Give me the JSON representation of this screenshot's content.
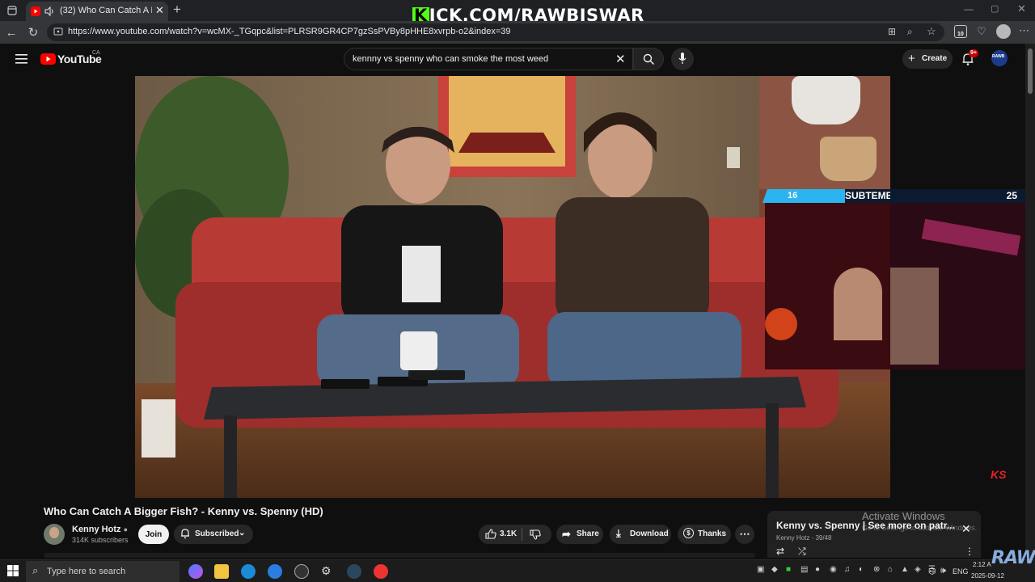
{
  "browser": {
    "tab_title": "(32) Who Can Catch A Bigger",
    "url": "https://www.youtube.com/watch?v=wcMX-_TGqpc&list=PLRSR9GR4CP7gzSsPVBy8pHHE8xvrpb-o2&index=39",
    "extensions_badge": "10"
  },
  "overlay": {
    "brand_k": "K",
    "brand_rest": "ICK.COM/RAWBISWAR"
  },
  "youtube": {
    "logo_text": "YouTube",
    "country_code": "CA",
    "search_query": "kennny vs spenny who can smoke the most weed",
    "create_label": "Create",
    "notif_count": "9+",
    "avatar_text": "RAWB"
  },
  "stream": {
    "goal_start": "16",
    "goal_label": "SUBTEMBER SUB GOAL",
    "goal_end": "25",
    "video_logo": "KS"
  },
  "video": {
    "title": "Who Can Catch A Bigger Fish? - Kenny vs. Spenny (HD)",
    "channel_name": "Kenny Hotz",
    "subscribers": "314K subscribers",
    "join_label": "Join",
    "subscribed_label": "Subscribed",
    "likes": "3.1K",
    "share_label": "Share",
    "download_label": "Download",
    "thanks_label": "Thanks"
  },
  "playlist": {
    "title": "Kenny vs. Spenny | See more on patr...",
    "meta": "Kenny Hotz - 39/48"
  },
  "windows": {
    "activate_title": "Activate Windows",
    "activate_sub": "Go to Settings to activate Windows.",
    "search_placeholder": "Type here to search",
    "lang": "ENG",
    "time": "2:12 A",
    "date": "2025-09-12",
    "raw_watermark": "RAW"
  },
  "colors": {
    "youtube_red": "#ff0000",
    "kick_green": "#53fc18",
    "goal_bar": "#2cb4f0"
  }
}
